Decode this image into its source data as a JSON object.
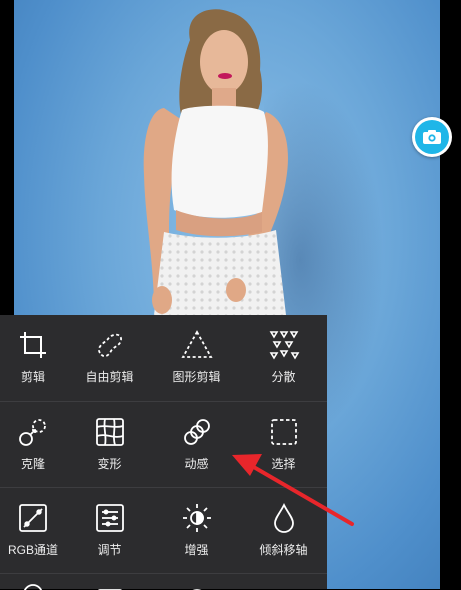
{
  "tools": [
    {
      "key": "crop",
      "label": "剪辑",
      "icon": "crop-icon"
    },
    {
      "key": "free-crop",
      "label": "自由剪辑",
      "icon": "free-crop-icon"
    },
    {
      "key": "shape-crop",
      "label": "图形剪辑",
      "icon": "triangle-crop-icon"
    },
    {
      "key": "disperse",
      "label": "分散",
      "icon": "disperse-icon"
    },
    {
      "key": "clone",
      "label": "克隆",
      "icon": "clone-icon"
    },
    {
      "key": "transform",
      "label": "变形",
      "icon": "grid-warp-icon"
    },
    {
      "key": "motion",
      "label": "动感",
      "icon": "motion-icon"
    },
    {
      "key": "select",
      "label": "选择",
      "icon": "dashed-select-icon"
    },
    {
      "key": "rgb-channel",
      "label": "RGB通道",
      "icon": "curve-icon"
    },
    {
      "key": "adjust",
      "label": "调节",
      "icon": "sliders-icon"
    },
    {
      "key": "enhance",
      "label": "增强",
      "icon": "sun-enhance-icon"
    },
    {
      "key": "tilt-shift",
      "label": "倾斜移轴",
      "icon": "drop-icon"
    }
  ],
  "floating_button": {
    "icon": "camera-icon"
  },
  "colors": {
    "panel": "#2c2c2e",
    "accent": "#1fb6e8",
    "annotation_arrow": "#e8262b",
    "background_blue": "#5f9bd3"
  }
}
